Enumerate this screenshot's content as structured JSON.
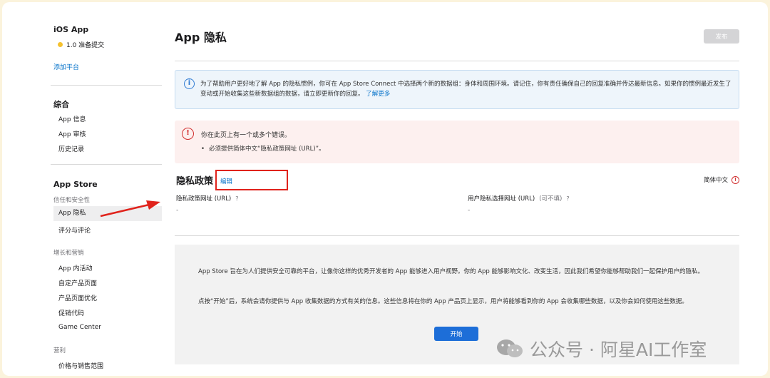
{
  "sidebar": {
    "app_title": "iOS App",
    "status": "1.0 准备提交",
    "add_platform": "添加平台",
    "general": {
      "heading": "综合",
      "items": [
        "App 信息",
        "App 审核",
        "历史记录"
      ]
    },
    "app_store": {
      "heading": "App Store",
      "trust_heading": "信任和安全性",
      "trust_items": [
        "App 隐私",
        "评分与评论"
      ],
      "growth_heading": "增长和营销",
      "growth_items": [
        "App 内活动",
        "自定产品页面",
        "产品页面优化",
        "促销代码",
        "Game Center"
      ],
      "monetize_heading": "营利",
      "monetize_items": [
        "价格与销售范围"
      ]
    }
  },
  "main": {
    "title": "App 隐私",
    "publish_label": "发布",
    "info": {
      "text": "为了帮助用户更好地了解 App 的隐私惯例，你可在 App Store Connect 中选择两个新的数据组：身体和周围环境。请记住，你有责任确保自己的回复准确并传达最新信息。如果你的惯例最近发生了变动或开始收集这些新数据组的数据，请立即更新你的回复。",
      "link": "了解更多"
    },
    "error": {
      "title": "你在此页上有一个或多个错误。",
      "item": "必须提供简体中文“隐私政策网址 (URL)”。"
    },
    "privacy_policy": {
      "heading": "隐私政策",
      "edit_label": "编辑",
      "language": "简体中文",
      "policy_url_label": "隐私政策网址 (URL)",
      "policy_url_value": "-",
      "choice_url_label": "用户隐私选择网址 (URL)",
      "choice_url_optional": "(可不填)",
      "choice_url_value": "-",
      "help_mark": "?"
    },
    "intro": {
      "p1": "App Store 旨在为人们提供安全可靠的平台，让像你这样的优秀开发者的 App 能够进入用户视野。你的 App 能够影响文化、改变生活，因此我们希望你能够帮助我们一起保护用户的隐私。",
      "p2": "点按“开始”后，系统会请你提供与 App 收集数据的方式有关的信息。这些信息将在你的 App 产品页上显示，用户将能够看到你的 App 会收集哪些数据，以及你会如何使用这些数据。",
      "start_label": "开始"
    }
  },
  "watermark": "公众号 · 阿星AI工作室",
  "colors": {
    "accent_blue": "#0070c9",
    "error_red": "#d12f2f",
    "annotation_red": "#e0231c",
    "status_yellow": "#f5c12e"
  }
}
